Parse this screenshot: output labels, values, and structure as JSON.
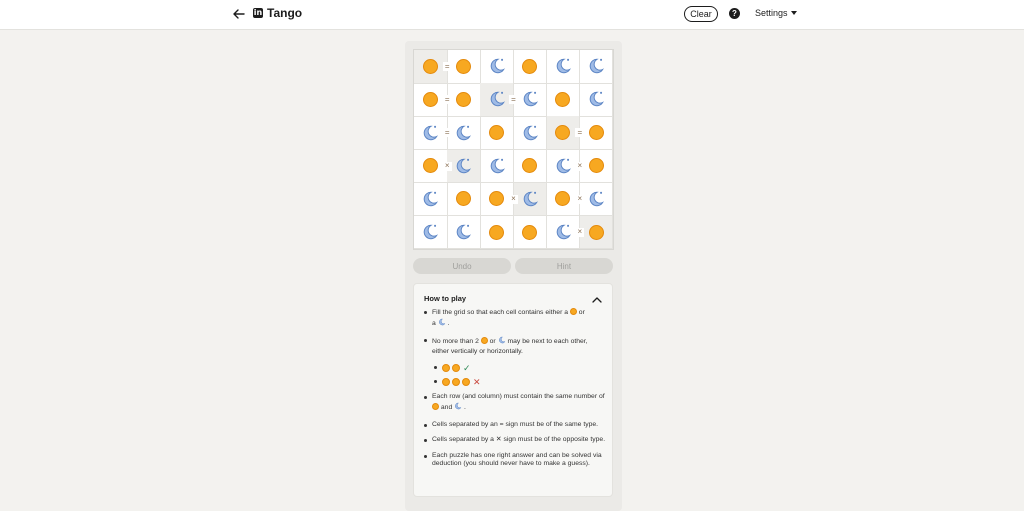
{
  "header": {
    "brand_title": "Tango",
    "brand_logo": "in",
    "clear_label": "Clear",
    "help_label": "?",
    "settings_label": "Settings"
  },
  "board": {
    "rows": [
      [
        "sun",
        "sun",
        "moon",
        "sun",
        "moon",
        "moon"
      ],
      [
        "sun",
        "sun",
        "moon",
        "moon",
        "sun",
        "moon"
      ],
      [
        "moon",
        "moon",
        "sun",
        "moon",
        "sun",
        "sun"
      ],
      [
        "sun",
        "moon",
        "moon",
        "sun",
        "moon",
        "sun"
      ],
      [
        "moon",
        "sun",
        "sun",
        "moon",
        "sun",
        "moon"
      ],
      [
        "moon",
        "moon",
        "sun",
        "sun",
        "moon",
        "sun"
      ]
    ],
    "locked": [
      [
        0,
        0
      ],
      [
        1,
        2
      ],
      [
        2,
        4
      ],
      [
        3,
        1
      ],
      [
        4,
        3
      ],
      [
        5,
        5
      ]
    ],
    "signs": [
      {
        "between": [
          [
            0,
            0
          ],
          [
            0,
            1
          ]
        ],
        "type": "="
      },
      {
        "between": [
          [
            1,
            0
          ],
          [
            1,
            1
          ]
        ],
        "type": "="
      },
      {
        "between": [
          [
            1,
            2
          ],
          [
            1,
            3
          ]
        ],
        "type": "="
      },
      {
        "between": [
          [
            2,
            0
          ],
          [
            2,
            1
          ]
        ],
        "type": "="
      },
      {
        "between": [
          [
            2,
            4
          ],
          [
            2,
            5
          ]
        ],
        "type": "="
      },
      {
        "between": [
          [
            3,
            0
          ],
          [
            3,
            1
          ]
        ],
        "type": "×"
      },
      {
        "between": [
          [
            3,
            4
          ],
          [
            3,
            5
          ]
        ],
        "type": "×"
      },
      {
        "between": [
          [
            4,
            2
          ],
          [
            4,
            3
          ]
        ],
        "type": "×"
      },
      {
        "between": [
          [
            4,
            4
          ],
          [
            4,
            5
          ]
        ],
        "type": "×"
      },
      {
        "between": [
          [
            5,
            4
          ],
          [
            5,
            5
          ]
        ],
        "type": "×"
      }
    ],
    "sun_color": "#f7a821",
    "moon_color": "#9fbbe6"
  },
  "controls": {
    "undo_label": "Undo",
    "hint_label": "Hint"
  },
  "howto": {
    "title": "How to play",
    "r1_a": "Fill the grid so that each cell contains either a ",
    "r1_b": " or",
    "r1_c": "a ",
    "r1_d": ".",
    "r2_a": "No more than 2 ",
    "r2_b": " or ",
    "r2_c": " may be next to each other, either vertically or horizontally.",
    "ex_ok": "✓",
    "ex_no": "✕",
    "r3_a": "Each row (and column) must contain the same number of ",
    "r3_b": " and ",
    "r3_c": ".",
    "r4": "Cells separated by an = sign must be of the same type.",
    "r5_a": "Cells separated by a ",
    "r5_sign": "✕",
    "r5_b": " sign must be of the opposite type.",
    "r6": "Each puzzle has one right answer and can be solved via deduction (you should never have to make a guess)."
  }
}
